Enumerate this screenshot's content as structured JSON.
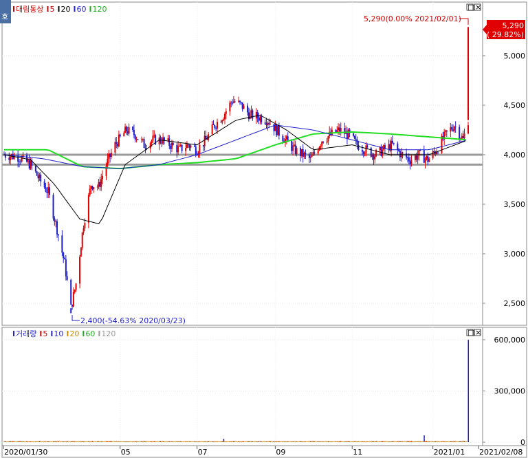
{
  "price_panel": {
    "corner_label": "호",
    "legend": [
      {
        "text": "대림통상",
        "color": "#cc0000"
      },
      {
        "text": "5",
        "color": "#cc0000"
      },
      {
        "text": "20",
        "color": "#000000"
      },
      {
        "text": "60",
        "color": "#1f1fcc"
      },
      {
        "text": "120",
        "color": "#22aa22"
      }
    ],
    "window_buttons": [
      "□",
      "×"
    ],
    "max_annotation": "5,290(0.00% 2021/02/01)",
    "min_annotation": "2,400(-54.63% 2020/03/23)",
    "current_price": "5,290",
    "current_change": "( 29.82%)"
  },
  "volume_panel": {
    "legend": [
      {
        "text": "거래량",
        "color": "#1f1fcc"
      },
      {
        "text": "5",
        "color": "#cc0000"
      },
      {
        "text": "10",
        "color": "#1f1fcc"
      },
      {
        "text": "20",
        "color": "#cc8800"
      },
      {
        "text": "60",
        "color": "#22aa22"
      },
      {
        "text": "120",
        "color": "#999999"
      }
    ],
    "window_buttons": [
      "□",
      "×"
    ]
  },
  "colors": {
    "up": "#e00000",
    "down": "#1f1fcc",
    "ma5": "#cc0000",
    "ma20": "#000000",
    "ma60": "#1f1fcc",
    "ma120": "#22dd22",
    "support": "#999999"
  },
  "chart_data": [
    {
      "type": "candlestick",
      "title": "대림통상",
      "y_ticks": [
        "5,000",
        "4,500",
        "4,000",
        "3,500",
        "3,000",
        "2,500"
      ],
      "y_tick_values": [
        5000,
        4500,
        4000,
        3500,
        3000,
        2500
      ],
      "ylim": [
        2250,
        5450
      ],
      "x_tick_labels": [
        "2020/01/30",
        "05",
        "07",
        "09",
        "11",
        "2021/01",
        "2021/02/08"
      ],
      "x_tick_dates": [
        "2020/01/30",
        "2020/05",
        "2020/07",
        "2020/09",
        "2020/11",
        "2021/01",
        "2021/02/08"
      ],
      "support_levels": [
        4000,
        3900
      ],
      "max": {
        "date": "2021/02/01",
        "value": 5290
      },
      "min": {
        "date": "2020/03/23",
        "value": 2400
      },
      "close_path": {
        "dates": [
          "2020/01/30",
          "2020/02/10",
          "2020/02/20",
          "2020/02/27",
          "2020/03/05",
          "2020/03/12",
          "2020/03/18",
          "2020/03/23",
          "2020/03/27",
          "2020/04/02",
          "2020/04/08",
          "2020/04/14",
          "2020/04/20",
          "2020/04/27",
          "2020/05/06",
          "2020/05/13",
          "2020/05/20",
          "2020/05/27",
          "2020/06/03",
          "2020/06/10",
          "2020/06/17",
          "2020/06/24",
          "2020/07/01",
          "2020/07/08",
          "2020/07/15",
          "2020/07/22",
          "2020/07/29",
          "2020/08/05",
          "2020/08/12",
          "2020/08/19",
          "2020/08/26",
          "2020/09/02",
          "2020/09/09",
          "2020/09/16",
          "2020/09/23",
          "2020/09/29",
          "2020/10/08",
          "2020/10/15",
          "2020/10/22",
          "2020/10/29",
          "2020/11/05",
          "2020/11/12",
          "2020/11/19",
          "2020/11/26",
          "2020/12/03",
          "2020/12/10",
          "2020/12/17",
          "2020/12/24",
          "2020/12/31",
          "2021/01/07",
          "2021/01/14",
          "2021/01/21",
          "2021/01/28",
          "2021/02/01"
        ],
        "values": [
          4000,
          3980,
          3900,
          3750,
          3620,
          3250,
          2900,
          2450,
          2700,
          3300,
          3700,
          3680,
          3900,
          4100,
          4250,
          4200,
          4100,
          4150,
          4150,
          4100,
          4050,
          4100,
          4050,
          4150,
          4300,
          4400,
          4550,
          4500,
          4400,
          4380,
          4350,
          4250,
          4150,
          4050,
          4000,
          3950,
          4150,
          4200,
          4250,
          4200,
          4100,
          4050,
          4000,
          4050,
          4100,
          4000,
          3950,
          4000,
          3950,
          4050,
          4200,
          4300,
          4150,
          4350
        ]
      },
      "ma120_path": {
        "dates": [
          "2020/01/30",
          "2020/03/05",
          "2020/04/01",
          "2020/05/01",
          "2020/06/01",
          "2020/07/01",
          "2020/08/01",
          "2020/09/01",
          "2020/10/01",
          "2020/11/01",
          "2020/12/01",
          "2021/01/01",
          "2021/02/01"
        ],
        "values": [
          4050,
          4050,
          3880,
          3860,
          3900,
          3920,
          3960,
          4100,
          4210,
          4230,
          4210,
          4180,
          4150
        ]
      },
      "ma60_path": {
        "dates": [
          "2020/01/30",
          "2020/03/01",
          "2020/04/01",
          "2020/05/01",
          "2020/06/01",
          "2020/07/01",
          "2020/08/01",
          "2020/09/01",
          "2020/10/01",
          "2020/11/01",
          "2020/12/01",
          "2021/01/01",
          "2021/02/01"
        ],
        "values": [
          4000,
          3960,
          3880,
          3860,
          3900,
          4000,
          4150,
          4300,
          4250,
          4150,
          4050,
          4050,
          4150
        ]
      },
      "ma20_path": {
        "dates": [
          "2020/01/30",
          "2020/02/20",
          "2020/03/10",
          "2020/03/30",
          "2020/04/15",
          "2020/05/05",
          "2020/06/01",
          "2020/07/01",
          "2020/08/01",
          "2020/08/20",
          "2020/09/10",
          "2020/10/01",
          "2020/11/01",
          "2020/12/01",
          "2021/01/01",
          "2021/02/01"
        ],
        "values": [
          4000,
          3950,
          3700,
          3350,
          3300,
          3900,
          4150,
          4100,
          4350,
          4400,
          4250,
          4050,
          4100,
          4000,
          4000,
          4150
        ]
      }
    },
    {
      "type": "bar",
      "title": "거래량",
      "y_ticks": [
        "600,000",
        "300,000",
        "0"
      ],
      "y_tick_values": [
        600000,
        300000,
        0
      ],
      "ylim": [
        0,
        640000
      ],
      "spikes": [
        {
          "date": "2020/07/22",
          "value": 20000
        },
        {
          "date": "2020/12/28",
          "value": 40000
        },
        {
          "date": "2021/02/01",
          "value": 600000
        }
      ]
    }
  ]
}
